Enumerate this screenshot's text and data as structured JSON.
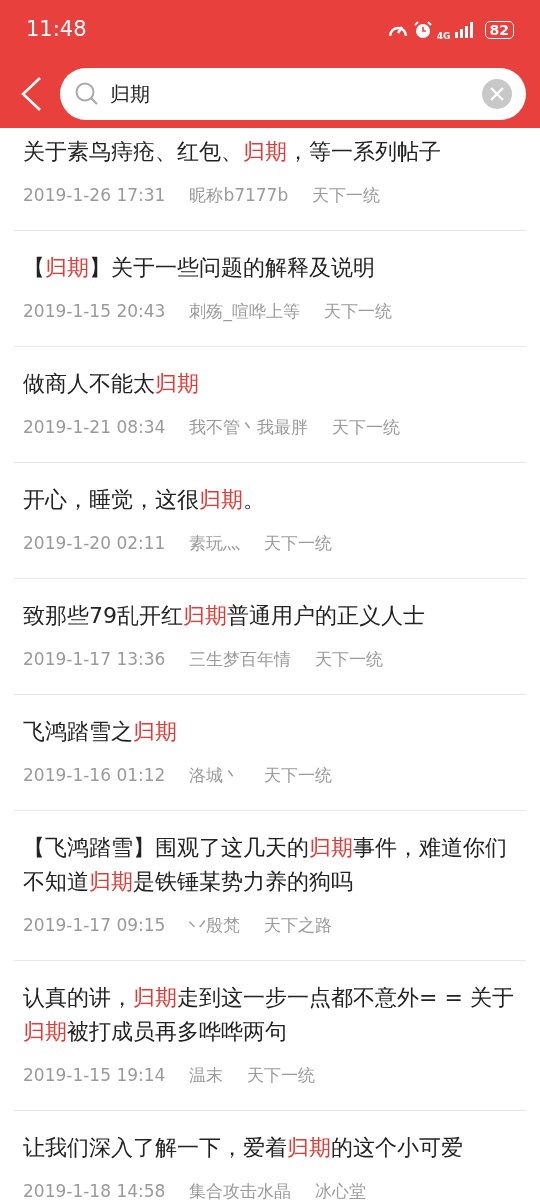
{
  "status_bar": {
    "time": "11:48",
    "network": "4G",
    "battery": "82"
  },
  "search": {
    "value": "归期"
  },
  "results": [
    {
      "title": [
        {
          "text": "关于素鸟痔疮、红包、",
          "highlight": false
        },
        {
          "text": "归期",
          "highlight": true
        },
        {
          "text": "，等一系列帖子",
          "highlight": false
        }
      ],
      "date": "2019-1-26 17:31",
      "author": "昵称b7177b",
      "forum": "天下一统"
    },
    {
      "title": [
        {
          "text": "【",
          "highlight": false
        },
        {
          "text": "归期",
          "highlight": true
        },
        {
          "text": "】关于一些问题的解释及说明",
          "highlight": false
        }
      ],
      "date": "2019-1-15 20:43",
      "author": "刺殇_喧哗上等",
      "forum": "天下一统"
    },
    {
      "title": [
        {
          "text": "做商人不能太",
          "highlight": false
        },
        {
          "text": "归期",
          "highlight": true
        }
      ],
      "date": "2019-1-21 08:34",
      "author": "我不管丶我最胖",
      "forum": "天下一统"
    },
    {
      "title": [
        {
          "text": "开心，睡觉，这很",
          "highlight": false
        },
        {
          "text": "归期",
          "highlight": true
        },
        {
          "text": "。",
          "highlight": false
        }
      ],
      "date": "2019-1-20 02:11",
      "author": "素玩灬",
      "forum": "天下一统"
    },
    {
      "title": [
        {
          "text": "致那些79乱开红",
          "highlight": false
        },
        {
          "text": "归期",
          "highlight": true
        },
        {
          "text": "普通用户的正义人士",
          "highlight": false
        }
      ],
      "date": "2019-1-17 13:36",
      "author": "三生梦百年情",
      "forum": "天下一统"
    },
    {
      "title": [
        {
          "text": "飞鸿踏雪之",
          "highlight": false
        },
        {
          "text": "归期",
          "highlight": true
        }
      ],
      "date": "2019-1-16 01:12",
      "author": "洛城丶",
      "forum": "天下一统"
    },
    {
      "title": [
        {
          "text": "【飞鸿踏雪】围观了这几天的",
          "highlight": false
        },
        {
          "text": "归期",
          "highlight": true
        },
        {
          "text": "事件，难道你们不知道",
          "highlight": false
        },
        {
          "text": "归期",
          "highlight": true
        },
        {
          "text": "是铁锤某势力养的狗吗",
          "highlight": false
        }
      ],
      "date": "2019-1-17 09:15",
      "author": "丷殷梵",
      "forum": "天下之路"
    },
    {
      "title": [
        {
          "text": "认真的讲，",
          "highlight": false
        },
        {
          "text": "归期",
          "highlight": true
        },
        {
          "text": "走到这一步一点都不意外= = 关于",
          "highlight": false
        },
        {
          "text": "归期",
          "highlight": true
        },
        {
          "text": "被打成员再多哗哗两句",
          "highlight": false
        }
      ],
      "date": "2019-1-15 19:14",
      "author": "温末",
      "forum": "天下一统"
    },
    {
      "title": [
        {
          "text": "让我们深入了解一下，爱着",
          "highlight": false
        },
        {
          "text": "归期",
          "highlight": true
        },
        {
          "text": "的这个小可爱",
          "highlight": false
        }
      ],
      "date": "2019-1-18 14:58",
      "author": "集合攻击水晶",
      "forum": "冰心堂"
    }
  ]
}
